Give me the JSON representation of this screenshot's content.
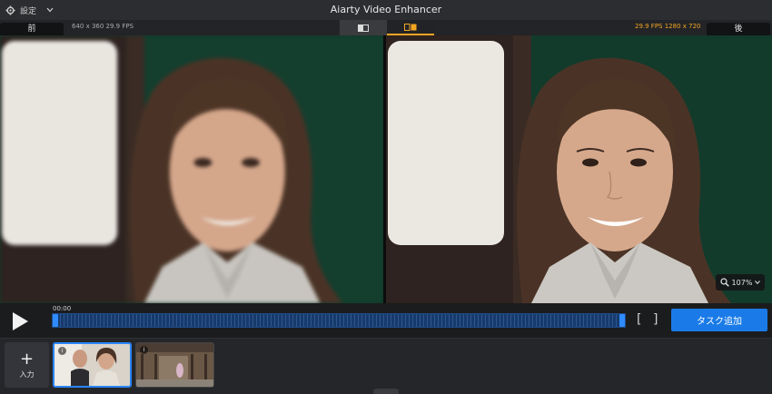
{
  "titlebar": {
    "settings_label": "設定",
    "title": "Aiarty Video Enhancer"
  },
  "infobar": {
    "before_label": "前",
    "after_label": "後",
    "source_info": "640 x 360  29.9 FPS",
    "output_info": "29.9 FPS   1280 x 720"
  },
  "viewer": {
    "zoom_level": "107%"
  },
  "controls": {
    "time": "00:00",
    "add_task_label": "タスク追加",
    "trim_start": "[",
    "trim_end": "]"
  },
  "thumbnails": {
    "input_label": "入力",
    "input_plus": "+",
    "info_glyph": "i"
  },
  "colors": {
    "accent_orange": "#f5a623",
    "accent_blue": "#1a7be8",
    "timeline_blue": "#173a6c"
  },
  "icons": [
    "gear-icon",
    "chevron-down-icon",
    "split-view-icon",
    "side-by-side-icon",
    "play-icon",
    "zoom-icon",
    "plus-icon",
    "info-icon"
  ]
}
